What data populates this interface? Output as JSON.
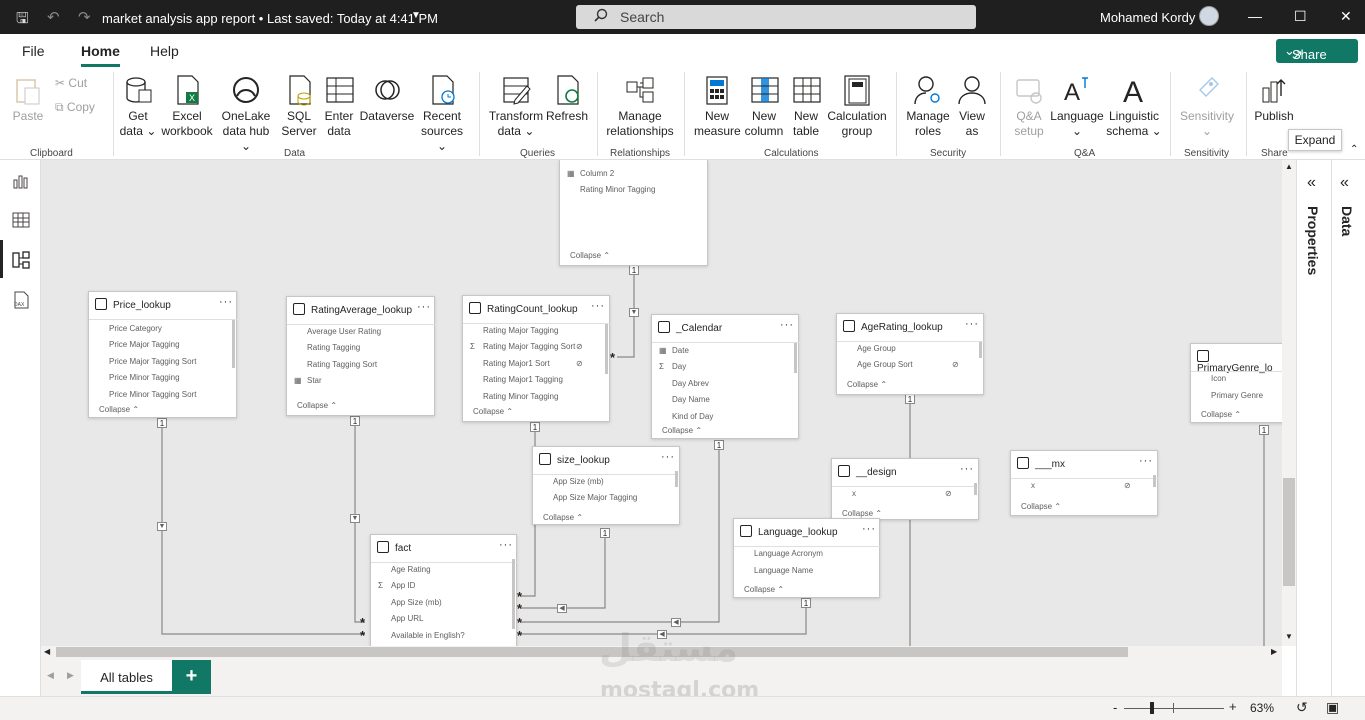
{
  "titlebar": {
    "title": "market analysis app report",
    "saved": "Last saved: Today at 4:41 PM",
    "search_placeholder": "Search",
    "user": "Mohamed Kordy"
  },
  "menu": {
    "file": "File",
    "home": "Home",
    "help": "Help",
    "share": "Share"
  },
  "ribbon": {
    "clipboard": {
      "paste": "Paste",
      "cut": "Cut",
      "copy": "Copy",
      "group": "Clipboard"
    },
    "data": {
      "get_data": [
        "Get",
        "data"
      ],
      "excel": [
        "Excel",
        "workbook"
      ],
      "onelake": [
        "OneLake",
        "data hub"
      ],
      "sql": [
        "SQL",
        "Server"
      ],
      "enter": [
        "Enter",
        "data"
      ],
      "dataverse": "Dataverse",
      "recent": [
        "Recent",
        "sources"
      ],
      "group": "Data"
    },
    "queries": {
      "transform": [
        "Transform",
        "data"
      ],
      "refresh": "Refresh",
      "group": "Queries"
    },
    "relationships": {
      "manage": [
        "Manage",
        "relationships"
      ],
      "group": "Relationships"
    },
    "calculations": {
      "new_measure": [
        "New",
        "measure"
      ],
      "new_column": [
        "New",
        "column"
      ],
      "new_table": [
        "New",
        "table"
      ],
      "calc_group": [
        "Calculation",
        "group"
      ],
      "group": "Calculations"
    },
    "security": {
      "manage_roles": [
        "Manage",
        "roles"
      ],
      "view_as": [
        "View",
        "as"
      ],
      "group": "Security"
    },
    "qa": {
      "qa_setup": [
        "Q&A",
        "setup"
      ],
      "language": "Language",
      "linguistic": [
        "Linguistic",
        "schema"
      ],
      "group": "Q&A"
    },
    "sensitivity": {
      "label": "Sensitivity",
      "group": "Sensitivity"
    },
    "share": {
      "publish": "Publish",
      "group": "Share"
    }
  },
  "tooltip": "Expand",
  "right_pane": {
    "properties": "Properties",
    "data": "Data"
  },
  "tabs": {
    "all_tables": "All tables",
    "add": "+"
  },
  "status": {
    "zoom": "63%",
    "minus": "-",
    "plus": "+"
  },
  "watermark": {
    "main": "مستقل",
    "site": "mostaql.com"
  },
  "tables": {
    "top": {
      "rows": [
        "Column 2",
        "Rating Minor Tagging"
      ],
      "collapse": "Collapse"
    },
    "price": {
      "name": "Price_lookup",
      "rows": [
        "Price Category",
        "Price Major Tagging",
        "Price Major Tagging Sort",
        "Price Minor Tagging",
        "Price Minor Tagging Sort"
      ],
      "collapse": "Collapse"
    },
    "ratingavg": {
      "name": "RatingAverage_lookup",
      "rows": [
        "Average User Rating",
        "Rating Tagging",
        "Rating Tagging Sort",
        "Star"
      ],
      "collapse": "Collapse"
    },
    "ratingcount": {
      "name": "RatingCount_lookup",
      "rows": [
        "Rating Major Tagging",
        "Rating Major Tagging Sort",
        "Rating Major1 Sort",
        "Rating Major1 Tagging",
        "Rating Minor Tagging"
      ],
      "collapse": "Collapse"
    },
    "calendar": {
      "name": "_Calendar",
      "rows": [
        "Date",
        "Day",
        "Day Abrev",
        "Day Name",
        "Kind of Day"
      ],
      "collapse": "Collapse"
    },
    "agerating": {
      "name": "AgeRating_lookup",
      "rows": [
        "Age Group",
        "Age Group Sort"
      ],
      "collapse": "Collapse"
    },
    "primarygenre": {
      "name": "PrimaryGenre_lo",
      "rows": [
        "Icon",
        "Primary Genre"
      ],
      "collapse": "Collapse"
    },
    "size": {
      "name": "size_lookup",
      "rows": [
        "App Size (mb)",
        "App Size Major Tagging"
      ],
      "collapse": "Collapse"
    },
    "design": {
      "name": "__design",
      "rows": [
        "x"
      ],
      "collapse": "Collapse"
    },
    "mx": {
      "name": "___mx",
      "rows": [
        "x"
      ],
      "collapse": "Collapse"
    },
    "language": {
      "name": "Language_lookup",
      "rows": [
        "Language Acronym",
        "Language Name"
      ],
      "collapse": "Collapse"
    },
    "fact": {
      "name": "fact",
      "rows": [
        "Age Rating",
        "App ID",
        "App Size (mb)",
        "App URL",
        "Available in English?"
      ]
    }
  },
  "cardinality": {
    "one": "1",
    "many": "*"
  }
}
